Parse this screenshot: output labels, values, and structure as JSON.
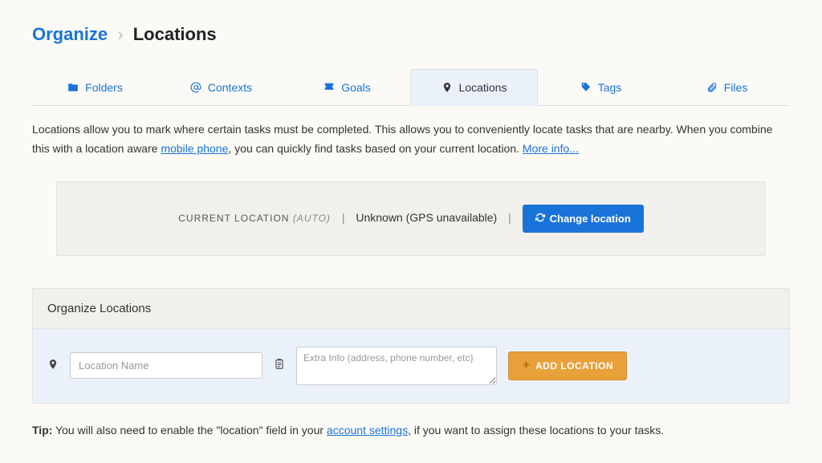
{
  "breadcrumb": {
    "top": "Organize",
    "current": "Locations"
  },
  "tabs": [
    {
      "label": "Folders"
    },
    {
      "label": "Contexts"
    },
    {
      "label": "Goals"
    },
    {
      "label": "Locations"
    },
    {
      "label": "Tags"
    },
    {
      "label": "Files"
    }
  ],
  "description": {
    "part1": "Locations allow you to mark where certain tasks must be completed. This allows you to conveniently locate tasks that are nearby. When you combine this with a location aware ",
    "link1": "mobile phone",
    "part2": ", you can quickly find tasks based on your current location. ",
    "link2": "More info..."
  },
  "locbar": {
    "label": "CURRENT LOCATION ",
    "auto": "(AUTO)",
    "status": "Unknown (GPS unavailable)",
    "button": "Change location"
  },
  "panel": {
    "title": "Organize Locations",
    "name_placeholder": "Location Name",
    "extra_placeholder": "Extra Info (address, phone number, etc)",
    "add_label": "ADD LOCATION"
  },
  "tip": {
    "strong": "Tip:",
    "part1": " You will also need to enable the \"location\" field in your ",
    "link": "account settings",
    "part2": ", if you want to assign these locations to your tasks."
  }
}
